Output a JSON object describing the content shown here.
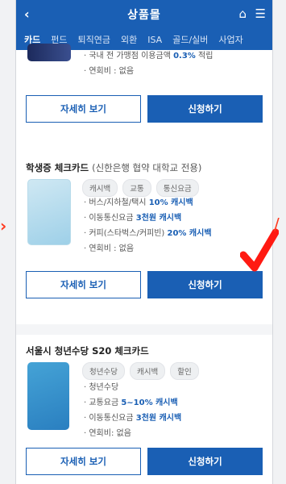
{
  "appbar": {
    "title": "상품몰"
  },
  "tabs": [
    "카드",
    "펀드",
    "퇴직연금",
    "외환",
    "ISA",
    "골드/실버",
    "사업자"
  ],
  "card1": {
    "bullets": [
      {
        "prefix": "국내 전 가맹점 이용금액 ",
        "hl": "0.3%",
        "suffix": " 적립"
      },
      {
        "prefix": "연회비 : 없음",
        "hl": "",
        "suffix": ""
      }
    ],
    "detail_label": "자세히 보기",
    "apply_label": "신청하기"
  },
  "card2": {
    "title": "학생증 체크카드",
    "subtitle": "(신한은행 협약 대학교 전용)",
    "tags": [
      "캐시백",
      "교통",
      "통신요금"
    ],
    "bullets": [
      {
        "prefix": "버스/지하철/택시 ",
        "hl": "10% 캐시백",
        "suffix": ""
      },
      {
        "prefix": "이동통신요금 ",
        "hl": "3천원 캐시백",
        "suffix": ""
      },
      {
        "prefix": "커피(스타벅스/커피빈) ",
        "hl": "20% 캐시백",
        "suffix": ""
      },
      {
        "prefix": "연회비 : 없음",
        "hl": "",
        "suffix": ""
      }
    ],
    "detail_label": "자세히 보기",
    "apply_label": "신청하기"
  },
  "card3": {
    "title": "서울시 청년수당 S20 체크카드",
    "tags": [
      "청년수당",
      "캐시백",
      "할인"
    ],
    "bullets": [
      {
        "prefix": "청년수당",
        "hl": "",
        "suffix": ""
      },
      {
        "prefix": "교통요금 ",
        "hl": "5~10% 캐시백",
        "suffix": ""
      },
      {
        "prefix": "이동통신요금 ",
        "hl": "3천원 캐시백",
        "suffix": ""
      },
      {
        "prefix": "연회비: 없음",
        "hl": "",
        "suffix": ""
      }
    ],
    "detail_label": "자세히 보기",
    "apply_label": "신청하기"
  },
  "colors": {
    "brand": "#1a5fb4",
    "highlight": "#ff3a1f"
  }
}
